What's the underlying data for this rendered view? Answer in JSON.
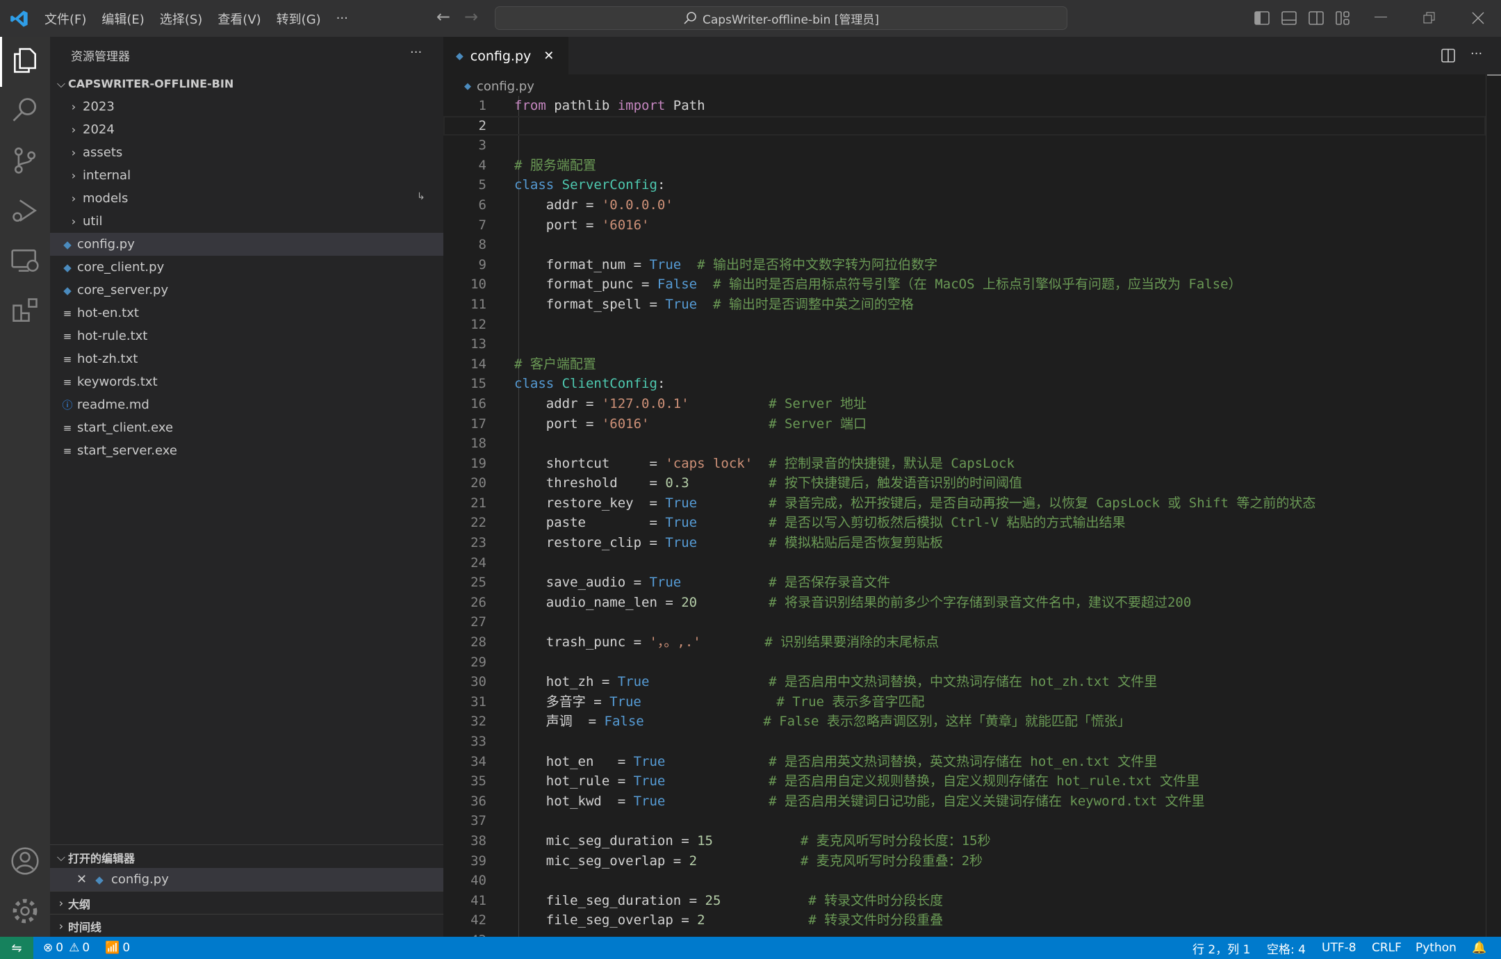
{
  "titlebar": {
    "menus": [
      "文件(F)",
      "编辑(E)",
      "选择(S)",
      "查看(V)",
      "转到(G)",
      "···"
    ],
    "search": "CapsWriter-offline-bin [管理员]"
  },
  "sidebar": {
    "title": "资源管理器",
    "more": "···",
    "root": "CAPSWRITER-OFFLINE-BIN",
    "tree": [
      {
        "label": "2023",
        "type": "folder"
      },
      {
        "label": "2024",
        "type": "folder"
      },
      {
        "label": "assets",
        "type": "folder"
      },
      {
        "label": "internal",
        "type": "folder"
      },
      {
        "label": "models",
        "type": "folder"
      },
      {
        "label": "util",
        "type": "folder"
      },
      {
        "label": "config.py",
        "type": "python",
        "selected": true
      },
      {
        "label": "core_client.py",
        "type": "python"
      },
      {
        "label": "core_server.py",
        "type": "python"
      },
      {
        "label": "hot-en.txt",
        "type": "text"
      },
      {
        "label": "hot-rule.txt",
        "type": "text"
      },
      {
        "label": "hot-zh.txt",
        "type": "text"
      },
      {
        "label": "keywords.txt",
        "type": "text"
      },
      {
        "label": "readme.md",
        "type": "info"
      },
      {
        "label": "start_client.exe",
        "type": "text"
      },
      {
        "label": "start_server.exe",
        "type": "text"
      }
    ],
    "open_editors": "打开的编辑器",
    "open_file": "config.py",
    "outline": "大纲",
    "timeline": "时间线"
  },
  "editor": {
    "tab": "config.py",
    "breadcrumb": "config.py",
    "current_line": 2,
    "lines": [
      [
        [
          "k",
          "from"
        ],
        [
          "t",
          " pathlib "
        ],
        [
          "k",
          "import"
        ],
        [
          "t",
          " Path"
        ]
      ],
      [],
      [],
      [
        [
          "m",
          "# 服务端配置"
        ]
      ],
      [
        [
          "b",
          "class"
        ],
        [
          "t",
          " "
        ],
        [
          "c",
          "ServerConfig"
        ],
        [
          "t",
          ":"
        ]
      ],
      [
        [
          "t",
          "    addr = "
        ],
        [
          "s",
          "'0.0.0.0'"
        ]
      ],
      [
        [
          "t",
          "    port = "
        ],
        [
          "s",
          "'6016'"
        ]
      ],
      [],
      [
        [
          "t",
          "    format_num = "
        ],
        [
          "b",
          "True"
        ],
        [
          "t",
          "  "
        ],
        [
          "m",
          "# 输出时是否将中文数字转为阿拉伯数字"
        ]
      ],
      [
        [
          "t",
          "    format_punc = "
        ],
        [
          "b",
          "False"
        ],
        [
          "t",
          "  "
        ],
        [
          "m",
          "# 输出时是否启用标点符号引擎（在 MacOS 上标点引擎似乎有问题，应当改为 False）"
        ]
      ],
      [
        [
          "t",
          "    format_spell = "
        ],
        [
          "b",
          "True"
        ],
        [
          "t",
          "  "
        ],
        [
          "m",
          "# 输出时是否调整中英之间的空格"
        ]
      ],
      [],
      [],
      [
        [
          "m",
          "# 客户端配置"
        ]
      ],
      [
        [
          "b",
          "class"
        ],
        [
          "t",
          " "
        ],
        [
          "c",
          "ClientConfig"
        ],
        [
          "t",
          ":"
        ]
      ],
      [
        [
          "t",
          "    addr = "
        ],
        [
          "s",
          "'127.0.0.1'"
        ],
        [
          "t",
          "          "
        ],
        [
          "m",
          "# Server 地址"
        ]
      ],
      [
        [
          "t",
          "    port = "
        ],
        [
          "s",
          "'6016'"
        ],
        [
          "t",
          "               "
        ],
        [
          "m",
          "# Server 端口"
        ]
      ],
      [],
      [
        [
          "t",
          "    shortcut     = "
        ],
        [
          "s",
          "'caps lock'"
        ],
        [
          "t",
          "  "
        ],
        [
          "m",
          "# 控制录音的快捷键，默认是 CapsLock"
        ]
      ],
      [
        [
          "t",
          "    threshold    = "
        ],
        [
          "n",
          "0.3"
        ],
        [
          "t",
          "          "
        ],
        [
          "m",
          "# 按下快捷键后，触发语音识别的时间阈值"
        ]
      ],
      [
        [
          "t",
          "    restore_key  = "
        ],
        [
          "b",
          "True"
        ],
        [
          "t",
          "         "
        ],
        [
          "m",
          "# 录音完成，松开按键后，是否自动再按一遍，以恢复 CapsLock 或 Shift 等之前的状态"
        ]
      ],
      [
        [
          "t",
          "    paste        = "
        ],
        [
          "b",
          "True"
        ],
        [
          "t",
          "         "
        ],
        [
          "m",
          "# 是否以写入剪切板然后模拟 Ctrl-V 粘贴的方式输出结果"
        ]
      ],
      [
        [
          "t",
          "    restore_clip = "
        ],
        [
          "b",
          "True"
        ],
        [
          "t",
          "         "
        ],
        [
          "m",
          "# 模拟粘贴后是否恢复剪贴板"
        ]
      ],
      [],
      [
        [
          "t",
          "    save_audio = "
        ],
        [
          "b",
          "True"
        ],
        [
          "t",
          "           "
        ],
        [
          "m",
          "# 是否保存录音文件"
        ]
      ],
      [
        [
          "t",
          "    audio_name_len = "
        ],
        [
          "n",
          "20"
        ],
        [
          "t",
          "         "
        ],
        [
          "m",
          "# 将录音识别结果的前多少个字存储到录音文件名中，建议不要超过200"
        ]
      ],
      [],
      [
        [
          "t",
          "    trash_punc = "
        ],
        [
          "s",
          "'，。,.'"
        ],
        [
          "t",
          "        "
        ],
        [
          "m",
          "# 识别结果要消除的末尾标点"
        ]
      ],
      [],
      [
        [
          "t",
          "    hot_zh = "
        ],
        [
          "b",
          "True"
        ],
        [
          "t",
          "               "
        ],
        [
          "m",
          "# 是否启用中文热词替换，中文热词存储在 hot_zh.txt 文件里"
        ]
      ],
      [
        [
          "t",
          "    多音字 = "
        ],
        [
          "b",
          "True"
        ],
        [
          "t",
          "                 "
        ],
        [
          "m",
          "# True 表示多音字匹配"
        ]
      ],
      [
        [
          "t",
          "    声调  = "
        ],
        [
          "b",
          "False"
        ],
        [
          "t",
          "               "
        ],
        [
          "m",
          "# False 表示忽略声调区别，这样「黄章」就能匹配「慌张」"
        ]
      ],
      [],
      [
        [
          "t",
          "    hot_en   = "
        ],
        [
          "b",
          "True"
        ],
        [
          "t",
          "             "
        ],
        [
          "m",
          "# 是否启用英文热词替换，英文热词存储在 hot_en.txt 文件里"
        ]
      ],
      [
        [
          "t",
          "    hot_rule = "
        ],
        [
          "b",
          "True"
        ],
        [
          "t",
          "             "
        ],
        [
          "m",
          "# 是否启用自定义规则替换，自定义规则存储在 hot_rule.txt 文件里"
        ]
      ],
      [
        [
          "t",
          "    hot_kwd  = "
        ],
        [
          "b",
          "True"
        ],
        [
          "t",
          "             "
        ],
        [
          "m",
          "# 是否启用关键词日记功能，自定义关键词存储在 keyword.txt 文件里"
        ]
      ],
      [],
      [
        [
          "t",
          "    mic_seg_duration = "
        ],
        [
          "n",
          "15"
        ],
        [
          "t",
          "           "
        ],
        [
          "m",
          "# 麦克风听写时分段长度：15秒"
        ]
      ],
      [
        [
          "t",
          "    mic_seg_overlap = "
        ],
        [
          "n",
          "2"
        ],
        [
          "t",
          "             "
        ],
        [
          "m",
          "# 麦克风听写时分段重叠：2秒"
        ]
      ],
      [],
      [
        [
          "t",
          "    file_seg_duration = "
        ],
        [
          "n",
          "25"
        ],
        [
          "t",
          "           "
        ],
        [
          "m",
          "# 转录文件时分段长度"
        ]
      ],
      [
        [
          "t",
          "    file_seg_overlap = "
        ],
        [
          "n",
          "2"
        ],
        [
          "t",
          "             "
        ],
        [
          "m",
          "# 转录文件时分段重叠"
        ]
      ],
      []
    ]
  },
  "status": {
    "errors": "0",
    "warnings": "0",
    "ports": "0",
    "position": "行 2，列 1",
    "spaces": "空格: 4",
    "encoding": "UTF-8",
    "eol": "CRLF",
    "language": "Python"
  },
  "colors": {
    "accent": "#007acc",
    "keyword": "#c586c0",
    "builtin": "#569cd6",
    "class": "#4ec9b0",
    "string": "#ce9178",
    "number": "#b5cea8",
    "comment": "#6a9955"
  }
}
